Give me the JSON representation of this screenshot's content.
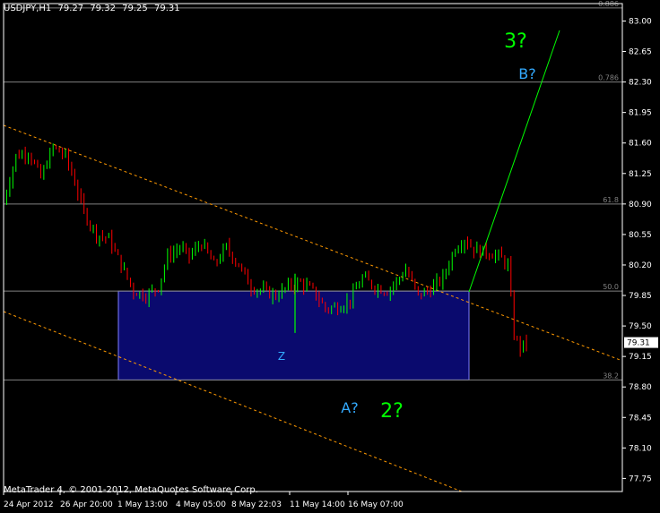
{
  "window": {
    "symbol": "USDJPY,H1",
    "ohlc": [
      "79.27",
      "79.32",
      "79.25",
      "79.31"
    ],
    "copyright": "MetaTrader 4, © 2001-2012, MetaQuotes Software Corp."
  },
  "colors": {
    "background": "#000000",
    "axis": "#ffffff",
    "bull_candle": "#00ff00",
    "bear_candle": "#ff0000",
    "fib_line": "#808080",
    "channel": "#ff9900",
    "zone_fill": "#0a0a6e",
    "zone_border": "#8080ff",
    "wave_green": "#00ff00",
    "wave_cyan": "#33aaff",
    "trend_line": "#00ff00",
    "price_label_bg": "#ffffff"
  },
  "chart_data": {
    "type": "candlestick",
    "symbol": "USDJPY",
    "timeframe": "H1",
    "ylim": [
      77.6,
      83.2
    ],
    "y_ticks": [
      "83.00",
      "82.65",
      "82.30",
      "81.95",
      "81.60",
      "81.25",
      "80.90",
      "80.55",
      "80.20",
      "79.85",
      "79.50",
      "79.15",
      "78.80",
      "78.45",
      "78.10",
      "77.75"
    ],
    "x_ticks": [
      "24 Apr 2012",
      "26 Apr 20:00",
      "1 May 13:00",
      "4 May 05:00",
      "8 May 22:03",
      "11 May 14:00",
      "16 May 07:00"
    ],
    "current_price": "79.31",
    "fib_levels": [
      {
        "label": "0.886",
        "value": 83.15
      },
      {
        "label": "0.786",
        "value": 82.3
      },
      {
        "label": "61.8",
        "value": 80.9
      },
      {
        "label": "50.0",
        "value": 79.9
      },
      {
        "label": "38.2",
        "value": 78.88
      }
    ],
    "zone": {
      "price_top": 79.9,
      "price_bottom": 78.88,
      "from": "1 May 13:00",
      "to": "16 May 07:00"
    },
    "wave_labels": [
      "3?",
      "B?",
      "A?",
      "2?",
      "Z"
    ],
    "price_path": [
      [
        0.0,
        80.93
      ],
      [
        0.02,
        81.45
      ],
      [
        0.04,
        81.5
      ],
      [
        0.06,
        81.2
      ],
      [
        0.08,
        81.55
      ],
      [
        0.1,
        81.45
      ],
      [
        0.115,
        81.15
      ],
      [
        0.13,
        80.8
      ],
      [
        0.15,
        80.55
      ],
      [
        0.17,
        80.5
      ],
      [
        0.19,
        80.2
      ],
      [
        0.21,
        79.9
      ],
      [
        0.23,
        79.85
      ],
      [
        0.25,
        79.95
      ],
      [
        0.265,
        80.3
      ],
      [
        0.285,
        80.4
      ],
      [
        0.3,
        80.3
      ],
      [
        0.32,
        80.45
      ],
      [
        0.34,
        80.2
      ],
      [
        0.36,
        80.4
      ],
      [
        0.38,
        80.2
      ],
      [
        0.4,
        79.95
      ],
      [
        0.42,
        79.9
      ],
      [
        0.44,
        79.85
      ],
      [
        0.46,
        79.95
      ],
      [
        0.48,
        80.0
      ],
      [
        0.5,
        79.9
      ],
      [
        0.52,
        79.7
      ],
      [
        0.54,
        79.72
      ],
      [
        0.56,
        79.8
      ],
      [
        0.58,
        80.05
      ],
      [
        0.6,
        79.95
      ],
      [
        0.62,
        79.9
      ],
      [
        0.64,
        80.05
      ],
      [
        0.65,
        80.15
      ],
      [
        0.67,
        79.85
      ],
      [
        0.69,
        79.92
      ],
      [
        0.71,
        80.05
      ],
      [
        0.73,
        80.4
      ],
      [
        0.745,
        80.5
      ],
      [
        0.76,
        80.38
      ],
      [
        0.78,
        80.35
      ],
      [
        0.8,
        80.3
      ],
      [
        0.815,
        80.2
      ],
      [
        0.825,
        79.4
      ],
      [
        0.835,
        79.25
      ],
      [
        0.845,
        79.31
      ]
    ]
  }
}
